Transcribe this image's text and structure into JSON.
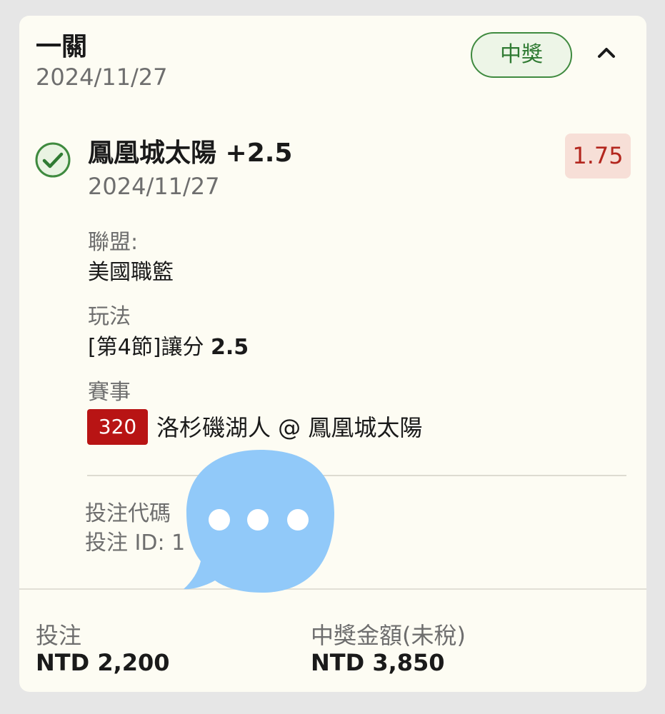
{
  "bet": {
    "type_title": "一關",
    "date": "2024/11/27",
    "status": "中獎"
  },
  "selection": {
    "title": "鳳凰城太陽 +2.5",
    "date": "2024/11/27",
    "odds": "1.75",
    "league_label": "聯盟:",
    "league_value": "美國職籃",
    "play_label": "玩法",
    "play_value_prefix": "[第4節]讓分 ",
    "play_value_line": "2.5",
    "event_label": "賽事",
    "event_number": "320",
    "event_teams": "洛杉磯湖人 @ 鳳凰城太陽"
  },
  "codes": {
    "bet_code_label": "投注代碼",
    "bet_id_label": "投注 ID: 1"
  },
  "footer": {
    "stake_label": "投注",
    "stake_value": "NTD 2,200",
    "payout_label": "中獎金額(未稅)",
    "payout_value": "NTD 3,850"
  },
  "icons": {
    "check": "check-circle-icon",
    "collapse": "chevron-up-icon",
    "overlay": "chat-bubble-icon"
  },
  "colors": {
    "win_green": "#2f7a32",
    "odds_red": "#b3261e",
    "event_badge": "#b81414",
    "overlay_blue": "#91c9f9"
  }
}
